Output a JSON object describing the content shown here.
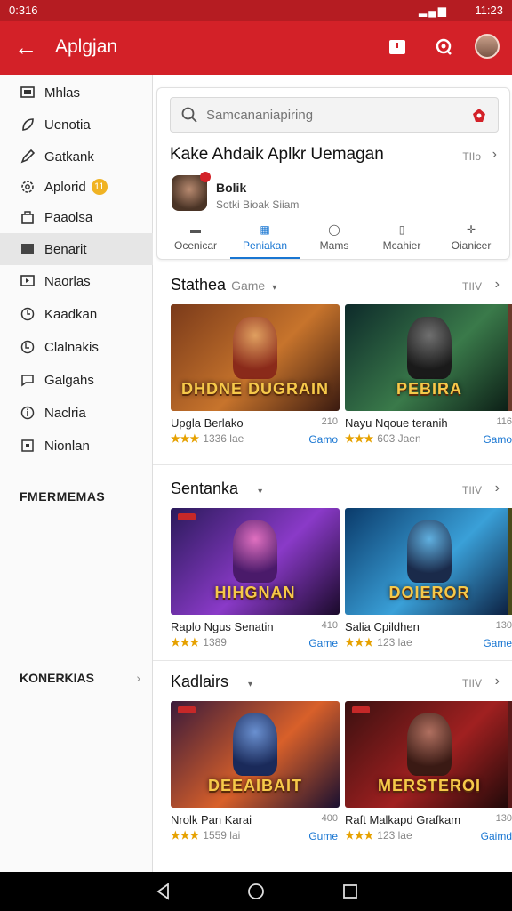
{
  "status": {
    "time_left": "0:316",
    "time_right": "11:23"
  },
  "appbar": {
    "title": "Aplgjan"
  },
  "sidebar": {
    "items": [
      {
        "label": "Mhlas",
        "icon": "monitor-icon"
      },
      {
        "label": "Uenotia",
        "icon": "leaf-icon"
      },
      {
        "label": "Gatkank",
        "icon": "pen-icon"
      },
      {
        "label": "Aplorid",
        "icon": "settings-icon",
        "badge": "11"
      },
      {
        "label": "Paaolsa",
        "icon": "bag-icon"
      },
      {
        "label": "Benarit",
        "icon": "folder-icon",
        "active": true
      },
      {
        "label": "Naorlas",
        "icon": "tv-icon"
      },
      {
        "label": "Kaadkan",
        "icon": "clock-icon"
      },
      {
        "label": "Clalnakis",
        "icon": "history-icon"
      },
      {
        "label": "Galgahs",
        "icon": "chat-icon"
      },
      {
        "label": "Naclria",
        "icon": "info-icon"
      },
      {
        "label": "Nionlan",
        "icon": "box-icon"
      }
    ],
    "heading": "FMERMEMAS",
    "more_label": "KONERKIAS"
  },
  "top_card": {
    "search_placeholder": "Samcananiapiring",
    "title": "Kake Ahdaik Aplkr Uemagan",
    "more": "TIIo",
    "app_name": "Bolik",
    "app_sub": "Sotki Bioak Siiam",
    "tabs": [
      {
        "label": "Ocenicar",
        "icon": "▬"
      },
      {
        "label": "Peniakan",
        "icon": "▦",
        "active": true
      },
      {
        "label": "Mams",
        "icon": "◯"
      },
      {
        "label": "Mcahier",
        "icon": "▯"
      },
      {
        "label": "Oianicer",
        "icon": "✛"
      }
    ]
  },
  "sections": [
    {
      "title": "Stathea",
      "tag": "Game",
      "more": "TIIV",
      "games": [
        {
          "name": "Upgla Berlako",
          "size": "210",
          "stars": "★★★",
          "count": "1336 lae",
          "category": "Gamo",
          "logo": "DHDNE DUGRAIN",
          "colors": [
            "#7a3a1a",
            "#c7742c",
            "#3a1a10"
          ]
        },
        {
          "name": "Nayu Nqoue teranih",
          "size": "116",
          "stars": "★★★",
          "count": "603 Jaen",
          "category": "Gamo",
          "logo": "PEBIRA",
          "colors": [
            "#0d2a2a",
            "#3a7a4a",
            "#0a1a14"
          ]
        }
      ]
    },
    {
      "title": "Sentanka",
      "tag": "",
      "more": "TIIV",
      "games": [
        {
          "name": "Raplo Ngus Senatin",
          "size": "410",
          "stars": "★★★",
          "count": "1389",
          "category": "Game",
          "logo": "HIHGNAN",
          "colors": [
            "#2a1a5a",
            "#8a3ac8",
            "#1a0a2a"
          ]
        },
        {
          "name": "Salia Cpildhen",
          "size": "130",
          "stars": "★★★",
          "count": "123 lae",
          "category": "Game",
          "logo": "DOIEROR",
          "colors": [
            "#0a3a6a",
            "#3aa0d8",
            "#0a1a3a"
          ]
        }
      ]
    },
    {
      "title": "Kadlairs",
      "tag": "",
      "more": "TIIV",
      "games": [
        {
          "name": "Nrolk Pan Karai",
          "size": "400",
          "stars": "★★★",
          "count": "1559 lai",
          "category": "Gume",
          "logo": "DEEAIBAIT",
          "colors": [
            "#3a1a3a",
            "#d8602a",
            "#1a1030"
          ]
        },
        {
          "name": "Raft Malkapd Grafkam",
          "size": "130",
          "stars": "★★★",
          "count": "123 lae",
          "category": "Gaimd",
          "logo": "MERSTEROI",
          "colors": [
            "#3a1010",
            "#a02020",
            "#1a0808"
          ]
        }
      ]
    }
  ]
}
